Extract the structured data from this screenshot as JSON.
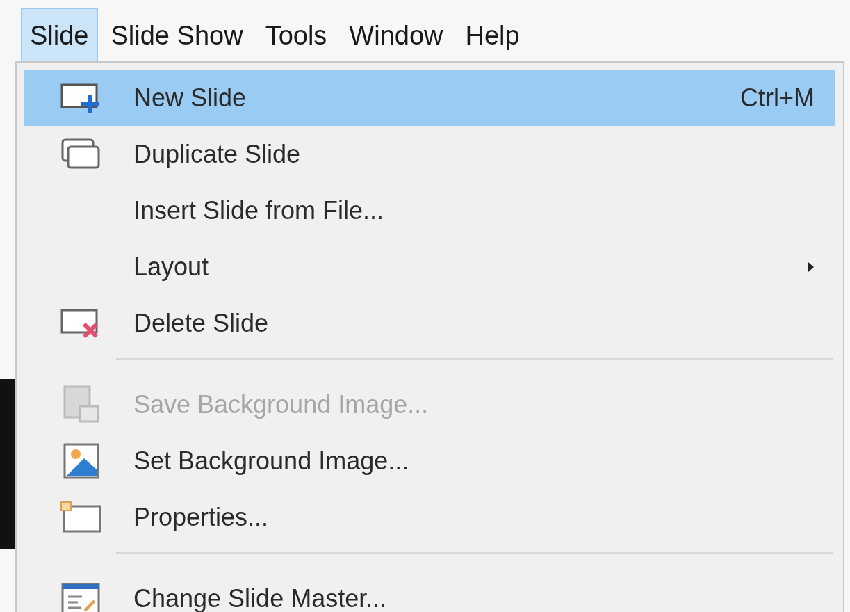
{
  "menu_bar": [
    {
      "label": "Slide",
      "selected": true
    },
    {
      "label": "Slide Show",
      "selected": false
    },
    {
      "label": "Tools",
      "selected": false
    },
    {
      "label": "Window",
      "selected": false
    },
    {
      "label": "Help",
      "selected": false
    }
  ],
  "menu": [
    {
      "kind": "item",
      "label": "New Slide",
      "shortcut": "Ctrl+M",
      "selected": true,
      "disabled": false,
      "submenu": false
    },
    {
      "kind": "item",
      "label": "Duplicate Slide",
      "selected": false,
      "disabled": false,
      "submenu": false
    },
    {
      "kind": "item",
      "label": "Insert Slide from File...",
      "selected": false,
      "disabled": false,
      "submenu": false
    },
    {
      "kind": "item",
      "label": "Layout",
      "selected": false,
      "disabled": false,
      "submenu": true
    },
    {
      "kind": "item",
      "label": "Delete Slide",
      "selected": false,
      "disabled": false,
      "submenu": false
    },
    {
      "kind": "separator"
    },
    {
      "kind": "item",
      "label": "Save Background Image...",
      "selected": false,
      "disabled": true,
      "submenu": false
    },
    {
      "kind": "item",
      "label": "Set Background Image...",
      "selected": false,
      "disabled": false,
      "submenu": false
    },
    {
      "kind": "item",
      "label": "Properties...",
      "selected": false,
      "disabled": false,
      "submenu": false
    },
    {
      "kind": "separator"
    },
    {
      "kind": "item",
      "label": "Change Slide Master...",
      "selected": false,
      "disabled": false,
      "submenu": false
    }
  ]
}
